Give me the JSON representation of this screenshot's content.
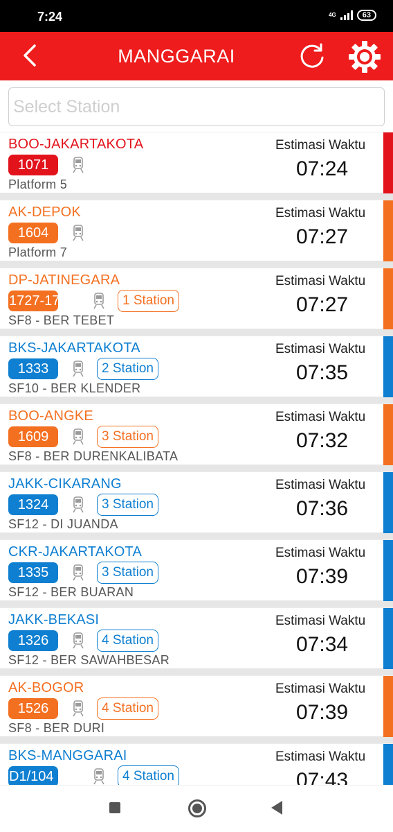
{
  "status": {
    "time": "7:24",
    "network": "4G",
    "battery": "63"
  },
  "header": {
    "title": "MANGGARAI"
  },
  "search": {
    "placeholder": "Select Station"
  },
  "colors": {
    "red": "#e3131c",
    "orange": "#f47021",
    "blue": "#0e7fd1"
  },
  "trains": [
    {
      "route": "BOO-JAKARTAKOTA",
      "number": "1071",
      "stations": "",
      "detail": "Platform 5",
      "estimate_label": "Estimasi Waktu",
      "time": "07:24",
      "line_color": "red"
    },
    {
      "route": "AK-DEPOK",
      "number": "1604",
      "stations": "",
      "detail": "Platform 7",
      "estimate_label": "Estimasi Waktu",
      "time": "07:27",
      "line_color": "orange"
    },
    {
      "route": "DP-JATINEGARA",
      "number": "1727-17",
      "stations": "1 Station",
      "detail": "SF8 - BER TEBET",
      "estimate_label": "Estimasi Waktu",
      "time": "07:27",
      "line_color": "orange"
    },
    {
      "route": "BKS-JAKARTAKOTA",
      "number": "1333",
      "stations": "2 Station",
      "detail": "SF10 - BER KLENDER",
      "estimate_label": "Estimasi Waktu",
      "time": "07:35",
      "line_color": "blue"
    },
    {
      "route": "BOO-ANGKE",
      "number": "1609",
      "stations": "3 Station",
      "detail": "SF8 - BER DURENKALIBATA",
      "estimate_label": "Estimasi Waktu",
      "time": "07:32",
      "line_color": "orange"
    },
    {
      "route": "JAKK-CIKARANG",
      "number": "1324",
      "stations": "3 Station",
      "detail": "SF12 - DI JUANDA",
      "estimate_label": "Estimasi Waktu",
      "time": "07:36",
      "line_color": "blue"
    },
    {
      "route": "CKR-JAKARTAKOTA",
      "number": "1335",
      "stations": "3 Station",
      "detail": "SF12 - BER BUARAN",
      "estimate_label": "Estimasi Waktu",
      "time": "07:39",
      "line_color": "blue"
    },
    {
      "route": "JAKK-BEKASI",
      "number": "1326",
      "stations": "4 Station",
      "detail": "SF12 - BER SAWAHBESAR",
      "estimate_label": "Estimasi Waktu",
      "time": "07:34",
      "line_color": "blue"
    },
    {
      "route": "AK-BOGOR",
      "number": "1526",
      "stations": "4 Station",
      "detail": "SF8 - BER DURI",
      "estimate_label": "Estimasi Waktu",
      "time": "07:39",
      "line_color": "orange"
    },
    {
      "route": "BKS-MANGGARAI",
      "number": "D1/104",
      "stations": "4 Station",
      "detail": "",
      "estimate_label": "Estimasi Waktu",
      "time": "07:43",
      "line_color": "blue"
    }
  ]
}
